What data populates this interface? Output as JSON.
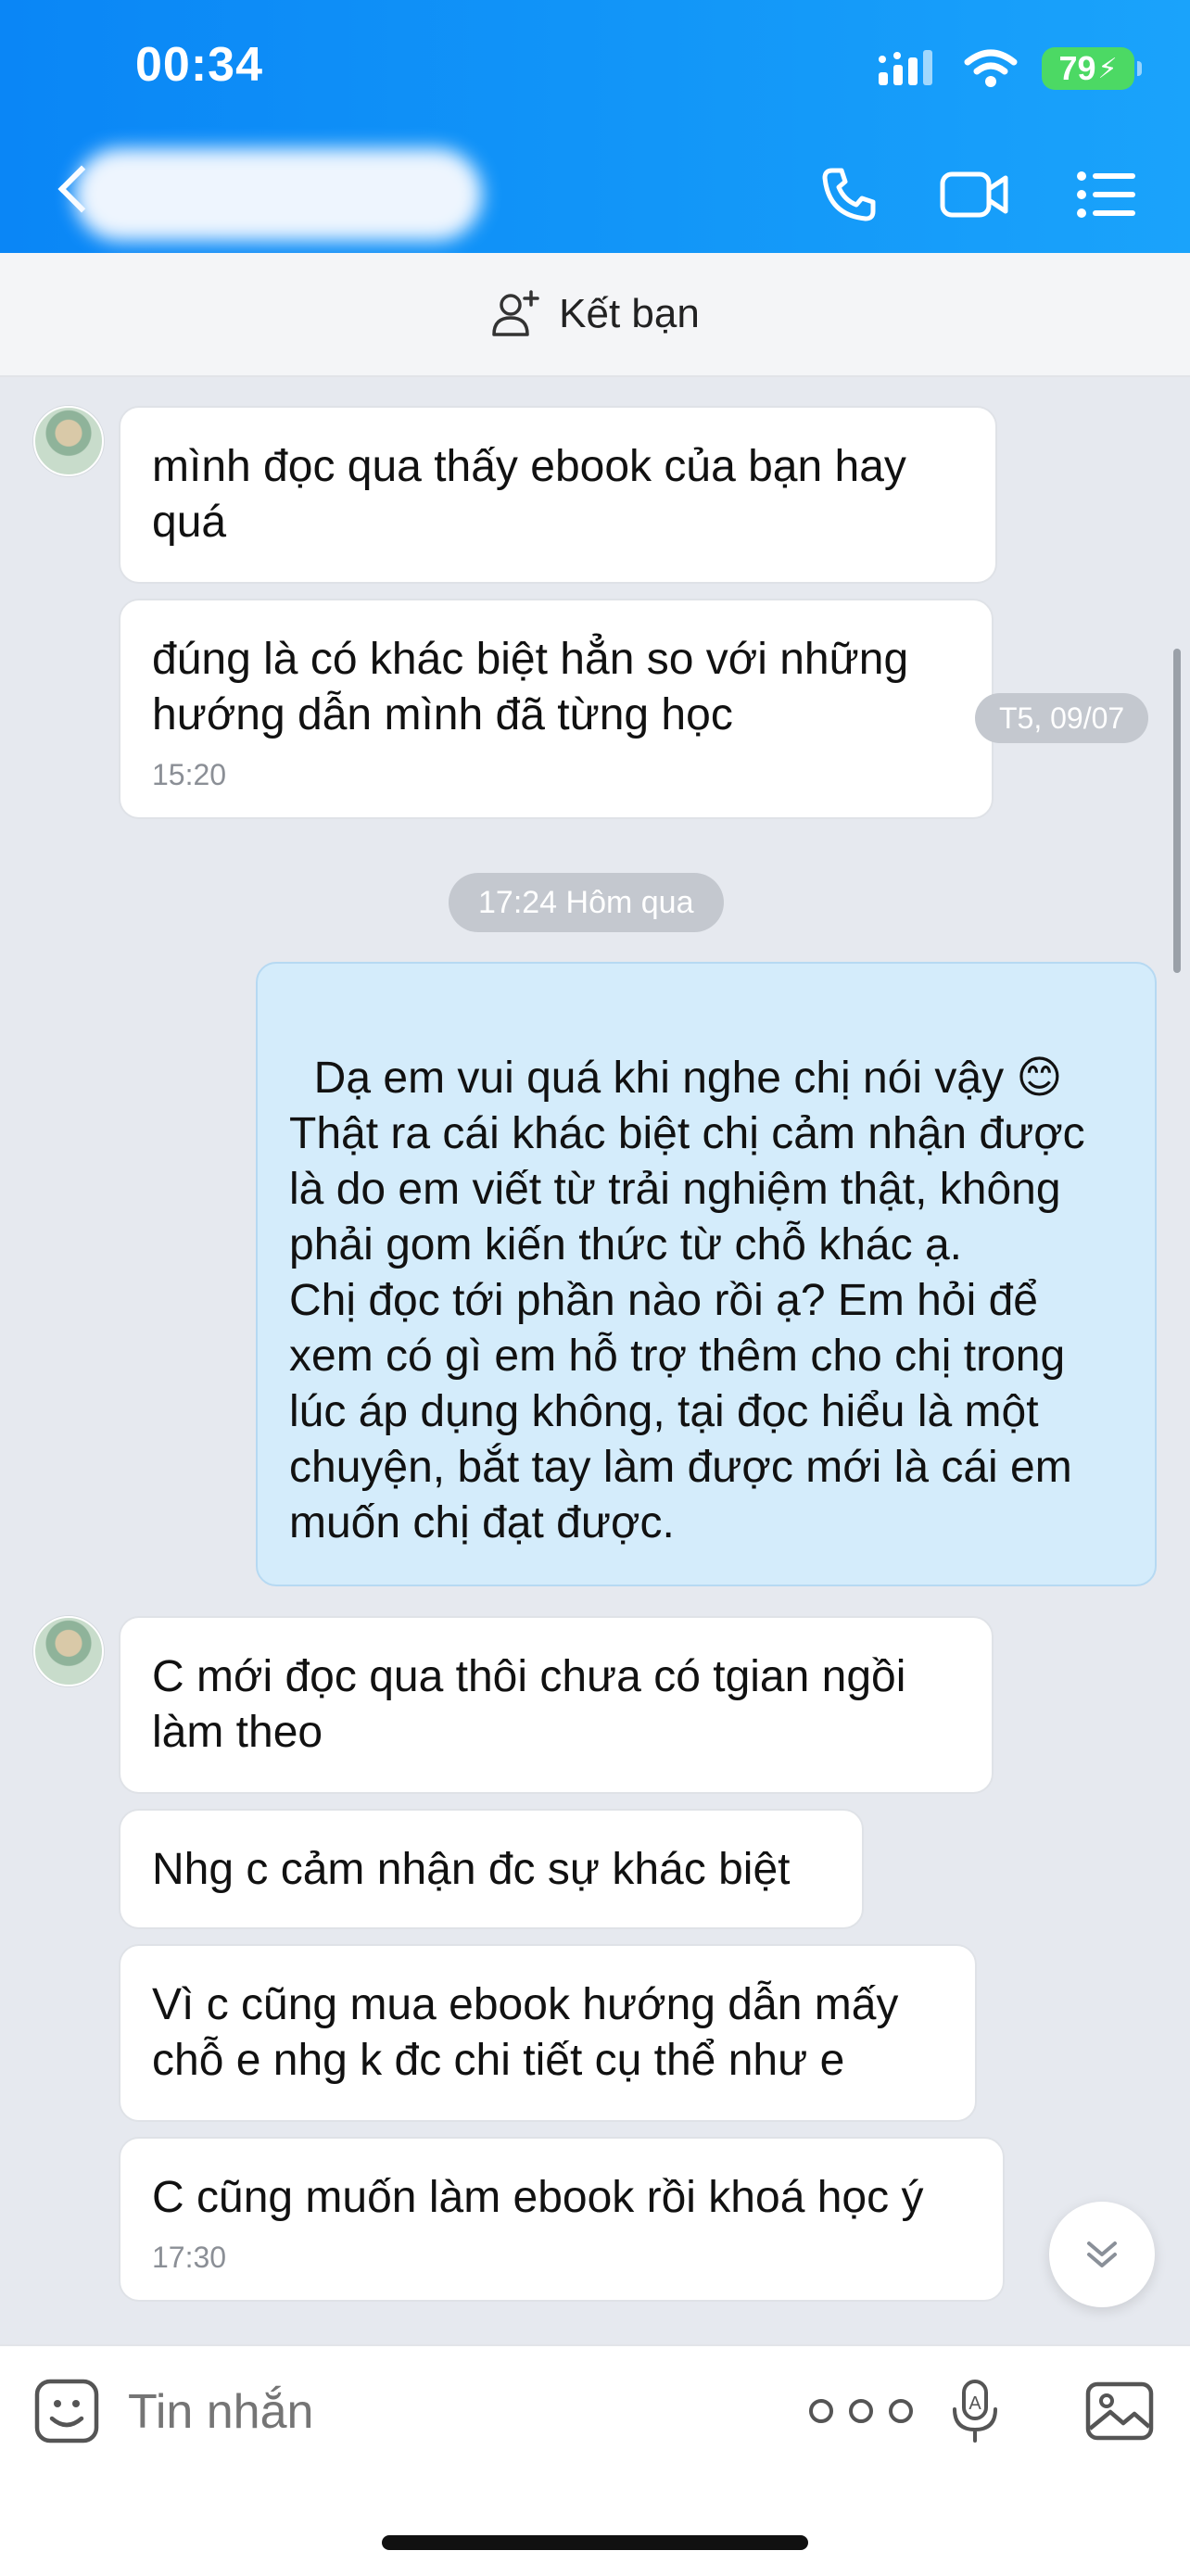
{
  "status_bar": {
    "time": "00:34",
    "battery": "79"
  },
  "header": {
    "contact_name": "",
    "call_icon": "phone-icon",
    "video_icon": "video-icon",
    "menu_icon": "list-menu-icon"
  },
  "add_friend": {
    "label": "Kết bạn"
  },
  "date_pills": {
    "side_date": "T5, 09/07",
    "divider": "17:24 Hôm qua"
  },
  "messages": [
    {
      "from": "them",
      "text": "mình đọc qua thấy ebook của bạn hay quá",
      "time": ""
    },
    {
      "from": "them",
      "text": "đúng là có khác biệt hẳn so với những hướng dẫn mình đã từng học",
      "time": "15:20"
    },
    {
      "from": "me",
      "text": "Dạ em vui quá khi nghe chị nói vậy 😊 Thật ra cái khác biệt chị cảm nhận được là do em viết từ trải nghiệm thật, không phải gom kiến thức từ chỗ khác ạ.\nChị đọc tới phần nào rồi ạ? Em hỏi để xem có gì em hỗ trợ thêm cho chị trong lúc áp dụng không, tại đọc hiểu là một chuyện, bắt tay làm được mới là cái em muốn chị đạt được.",
      "time": ""
    },
    {
      "from": "them",
      "text": "C mới đọc qua thôi chưa có tgian ngồi làm theo",
      "time": ""
    },
    {
      "from": "them",
      "text": "Nhg c cảm nhận đc sự khác biệt",
      "time": ""
    },
    {
      "from": "them",
      "text": "Vì c cũng mua ebook hướng dẫn mấy chỗ e nhg k đc chi tiết cụ thể như e",
      "time": ""
    },
    {
      "from": "them",
      "text": "C cũng muốn làm ebook rồi khoá học ý",
      "time": "17:30"
    }
  ],
  "input": {
    "placeholder": "Tin nhắn"
  },
  "colors": {
    "header": "#0a86f6",
    "my_bubble": "#d4ecfb",
    "background": "#e6e9ef"
  }
}
